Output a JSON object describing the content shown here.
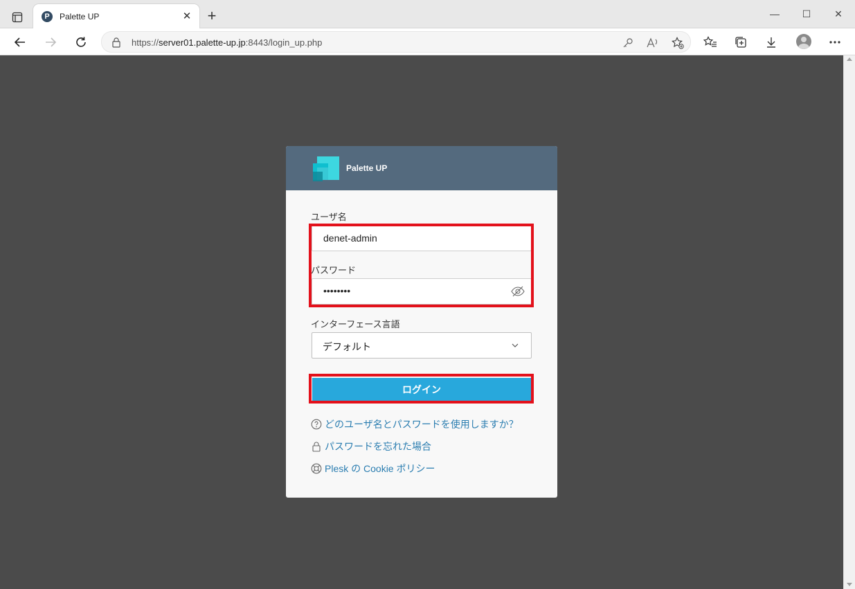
{
  "browser": {
    "tab_title": "Palette UP",
    "tab_favicon_letter": "P",
    "url_prefix": "https://",
    "url_host": "server01.palette-up.jp",
    "url_rest": ":8443/login_up.php"
  },
  "card": {
    "brand": "Palette UP",
    "username_label": "ユーザ名",
    "username_value": "denet-admin",
    "password_label": "パスワード",
    "password_value": "••••••••",
    "language_label": "インターフェース言語",
    "language_value": "デフォルト",
    "login_button": "ログイン",
    "links": [
      {
        "label": "どのユーザ名とパスワードを使用しますか？",
        "icon": "help-icon"
      },
      {
        "label": "パスワードを忘れた場合",
        "icon": "lock-icon"
      },
      {
        "label": "Plesk の Cookie ポリシー",
        "icon": "lifebuoy-icon"
      }
    ]
  },
  "colors": {
    "page_background": "#4b4b4b",
    "card_header": "#546a7e",
    "login_button": "#28a8dc",
    "highlight": "#e3111b",
    "link": "#2a7db0"
  }
}
